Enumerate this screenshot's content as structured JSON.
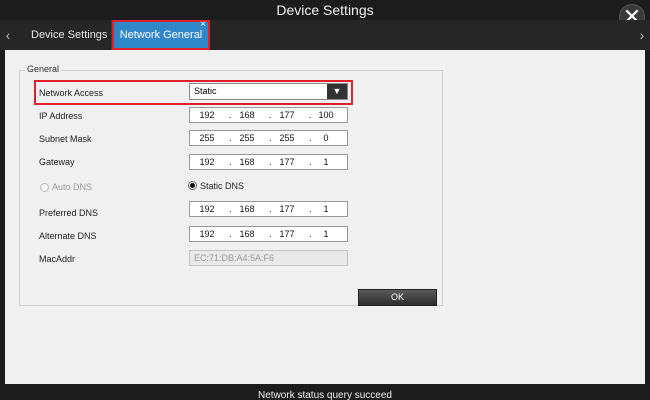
{
  "window": {
    "title": "Device Settings",
    "close_symbol": "✕"
  },
  "tabs": [
    {
      "label": "Device Settings",
      "active": false
    },
    {
      "label": "Network General",
      "active": true,
      "close_symbol": "×"
    }
  ],
  "nav": {
    "left_arrow": "‹",
    "right_arrow": "›"
  },
  "form": {
    "group_label": "General",
    "network_access": {
      "label": "Network Access",
      "value": "Static",
      "dropdown_symbol": "▼"
    },
    "ip_address": {
      "label": "IP Address",
      "octets": [
        "192",
        "168",
        "177",
        "100"
      ]
    },
    "subnet_mask": {
      "label": "Subnet Mask",
      "octets": [
        "255",
        "255",
        "255",
        "0"
      ]
    },
    "gateway": {
      "label": "Gateway",
      "octets": [
        "192",
        "168",
        "177",
        "1"
      ]
    },
    "auto_dns": {
      "label": "Auto DNS",
      "checked": false,
      "enabled": false
    },
    "static_dns": {
      "label": "Static DNS",
      "checked": true,
      "enabled": true
    },
    "preferred_dns": {
      "label": "Preferred DNS",
      "octets": [
        "192",
        "168",
        "177",
        "1"
      ]
    },
    "alternate_dns": {
      "label": "Alternate DNS",
      "octets": [
        "192",
        "168",
        "177",
        "1"
      ]
    },
    "mac_addr": {
      "label": "MacAddr",
      "value": "EC:71:DB:A4:5A:F6"
    },
    "ok_label": "OK"
  },
  "status": {
    "text": "Network status query succeed"
  },
  "colors": {
    "active_tab": "#2f86c9",
    "highlight_border": "#e0202a",
    "content_bg": "#f0f0f0",
    "chrome_bg": "#1b1b1b"
  }
}
